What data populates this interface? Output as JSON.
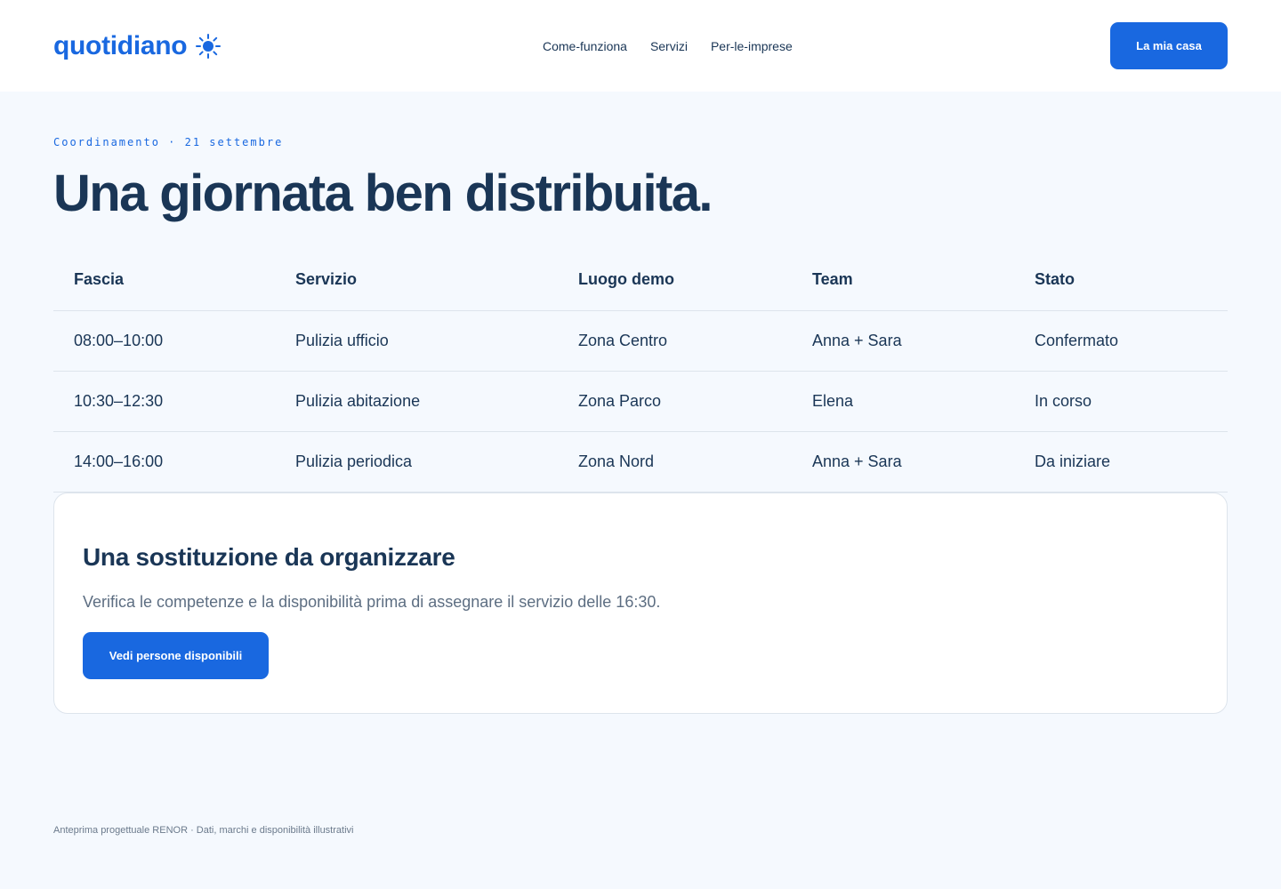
{
  "header": {
    "brand": "quotidiano",
    "brand_icon": "sun-icon",
    "nav": [
      {
        "label": "Come-funziona"
      },
      {
        "label": "Servizi"
      },
      {
        "label": "Per-le-imprese"
      }
    ],
    "cta_label": "La mia casa"
  },
  "colors": {
    "accent": "#1968e0",
    "heading": "#1a3656",
    "background": "#f5f9fe",
    "muted": "#5d6e82"
  },
  "main": {
    "eyebrow": "Coordinamento · 21 settembre",
    "title": "Una giornata ben distribuita.",
    "table": {
      "columns": [
        "Fascia",
        "Servizio",
        "Luogo demo",
        "Team",
        "Stato"
      ],
      "rows": [
        [
          "08:00–10:00",
          "Pulizia ufficio",
          "Zona Centro",
          "Anna + Sara",
          "Confermato"
        ],
        [
          "10:30–12:30",
          "Pulizia abitazione",
          "Zona Parco",
          "Elena",
          "In corso"
        ],
        [
          "14:00–16:00",
          "Pulizia periodica",
          "Zona Nord",
          "Anna + Sara",
          "Da iniziare"
        ]
      ]
    },
    "card": {
      "title": "Una sostituzione da organizzare",
      "text": "Verifica le competenze e la disponibilità prima di assegnare il servizio delle 16:30.",
      "button_label": "Vedi persone disponibili"
    }
  },
  "footer": {
    "text": "Anteprima progettuale RENOR · Dati, marchi e disponibilità illustrativi"
  }
}
